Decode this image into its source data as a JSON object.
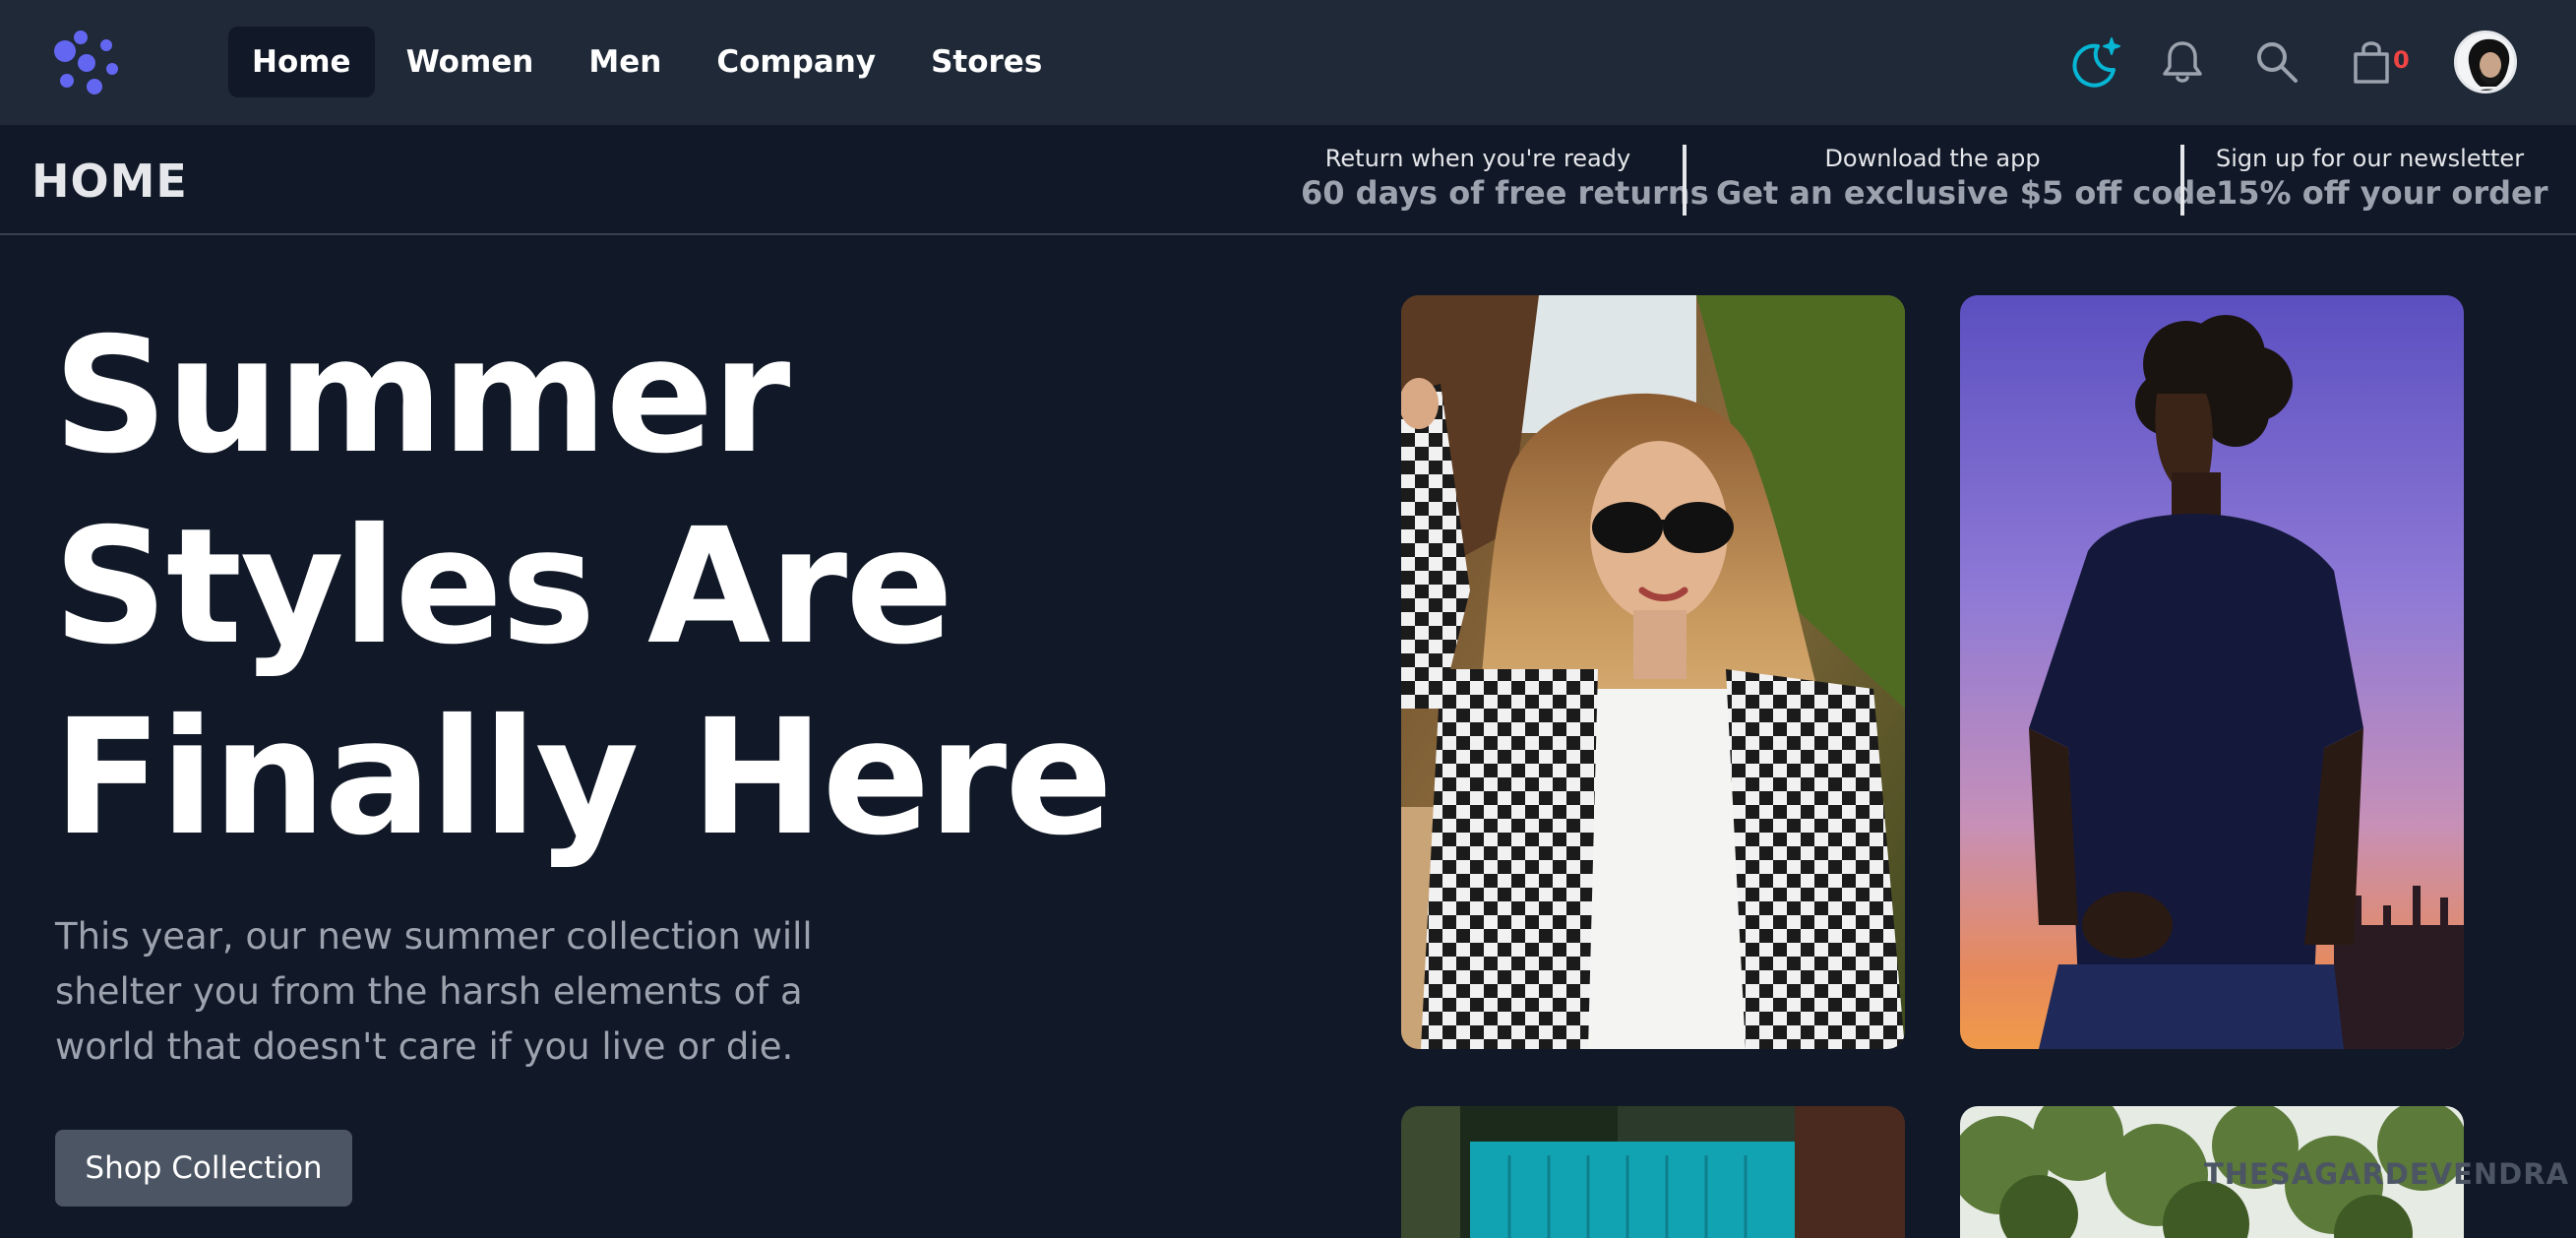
{
  "nav": {
    "logo_icon": "sparkle-dots-logo",
    "links": [
      {
        "label": "Home",
        "active": true
      },
      {
        "label": "Women",
        "active": false
      },
      {
        "label": "Men",
        "active": false
      },
      {
        "label": "Company",
        "active": false
      },
      {
        "label": "Stores",
        "active": false
      }
    ],
    "icons": [
      "moon-stars-icon",
      "bell-icon",
      "search-icon",
      "shopping-bag-icon"
    ],
    "cart_count": "0",
    "accent_color": "#6366f1",
    "theme_icon_color": "#06b6d4"
  },
  "subheader": {
    "page_label": "HOME",
    "promos": [
      {
        "small": "Return when you're ready",
        "big": "60 days of free returns"
      },
      {
        "small": "Download the app",
        "big": "Get an exclusive $5 off code"
      },
      {
        "small": "Sign up for our newsletter",
        "big": "15% off your order"
      }
    ]
  },
  "hero": {
    "title_lines": [
      "Summer",
      "Styles Are",
      "Finally Here"
    ],
    "description": "This year, our new summer collection will shelter you from the harsh elements of a world that doesn't care if you live or die.",
    "cta_label": "Shop Collection"
  },
  "watermark": "THESAGARDEVENDRA"
}
